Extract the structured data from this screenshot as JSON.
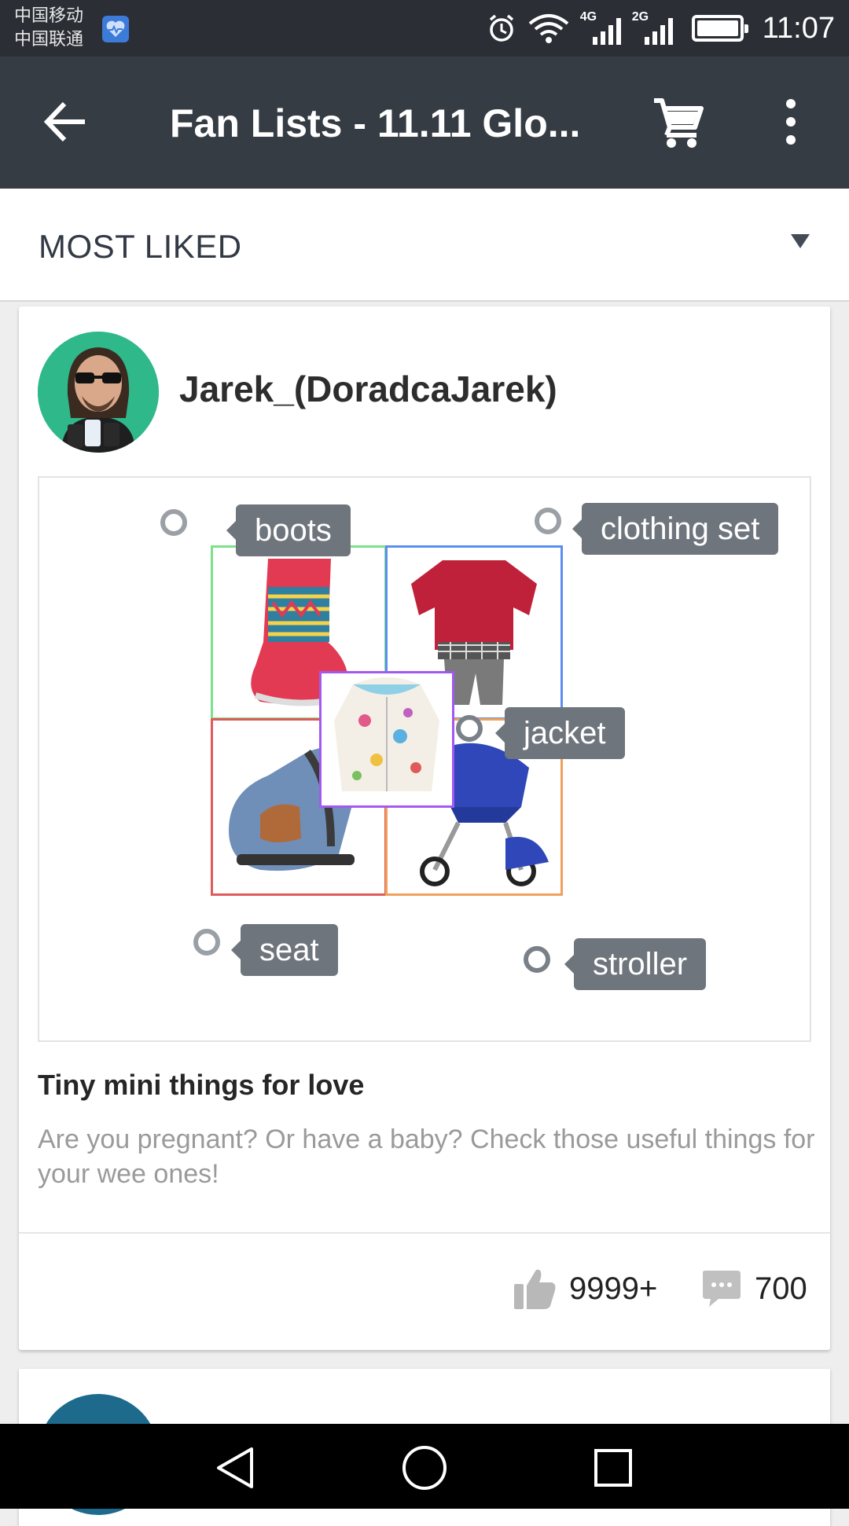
{
  "status_bar": {
    "carrier_1": "中国移动",
    "carrier_2": "中国联通",
    "net_1": "4G",
    "net_2": "2G",
    "time": "11:07"
  },
  "app_bar": {
    "title": "Fan Lists - 11.11 Glo..."
  },
  "sort": {
    "label": "MOST LIKED"
  },
  "post": {
    "username": "Jarek_(DoradcaJarek)",
    "tags": [
      {
        "label": "boots"
      },
      {
        "label": "clothing set"
      },
      {
        "label": "jacket"
      },
      {
        "label": "seat"
      },
      {
        "label": "stroller"
      }
    ],
    "title": "Tiny mini things for love",
    "description": "Are you pregnant? Or have a baby? Check those useful things for your wee ones!",
    "likes": "9999+",
    "comments": "700"
  },
  "colors": {
    "status_bar_bg": "#2b2f35",
    "app_bar_bg": "#363c44",
    "tag_bg": "#6f757d",
    "tile_boots_border": "#7ee08a",
    "tile_clothing_border": "#5b8ef0",
    "tile_seat_border": "#e05a5a",
    "tile_stroller_border": "#f0a05a",
    "tile_jacket_border": "#a259f0"
  }
}
